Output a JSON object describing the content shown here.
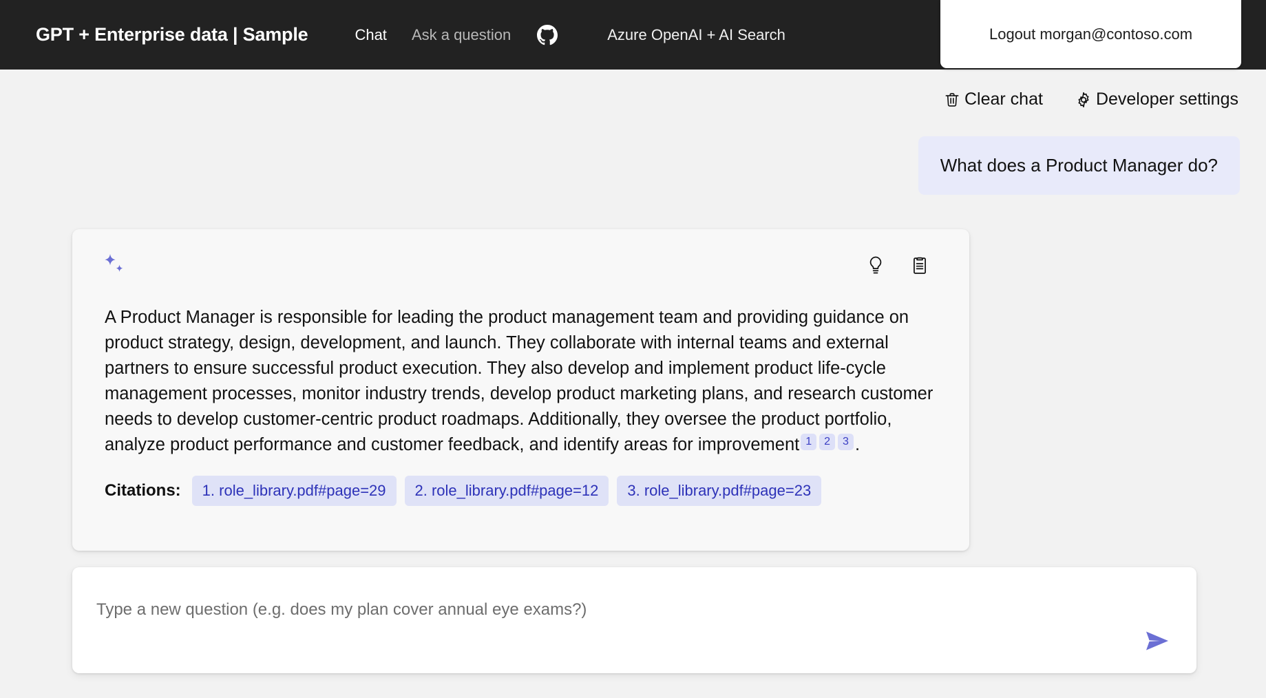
{
  "header": {
    "brand_title": "GPT + Enterprise data | Sample",
    "nav": [
      {
        "label": "Chat",
        "name": "nav-link-chat",
        "active": true
      },
      {
        "label": "Ask a question",
        "name": "nav-link-ask-a-question",
        "active": false
      }
    ],
    "github_icon": "github-icon",
    "azure_label": "Azure OpenAI + AI Search",
    "logout_label": "Logout morgan@contoso.com",
    "background_color": "#222222"
  },
  "toolbar": {
    "clear_chat_label": "Clear chat",
    "clear_chat_icon": "trash-icon",
    "developer_settings_label": "Developer settings",
    "developer_settings_icon": "gear-icon"
  },
  "conversation": {
    "user_message": "What does a Product Manager do?",
    "answer": {
      "avatar_icon": "sparkle-icon",
      "actions": [
        {
          "name": "thought-process-button",
          "icon": "lightbulb-icon"
        },
        {
          "name": "supporting-content-button",
          "icon": "clipboard-icon"
        }
      ],
      "text_part_1": "A Product Manager is responsible for leading the product management team and providing guidance on product strategy, design, development, and launch. They collaborate with internal teams and external partners to ensure successful product execution. They also develop and implement product life-cycle management processes, monitor industry trends, develop product marketing plans, and research customer needs to develop customer-centric product roadmaps. Additionally, they oversee the product portfolio, analyze product performance and customer feedback, and identify areas for improvement",
      "inline_citations": [
        "1",
        "2",
        "3"
      ],
      "text_part_2": ".",
      "citations_label": "Citations:",
      "citations": [
        "1. role_library.pdf#page=29",
        "2. role_library.pdf#page=12",
        "3. role_library.pdf#page=23"
      ]
    }
  },
  "question_input": {
    "value": "",
    "placeholder": "Type a new question (e.g. does my plan cover annual eye exams?)",
    "send_icon": "send-icon"
  },
  "colors": {
    "page_background": "#f2f2f2",
    "header_background": "#222222",
    "user_bubble": "#e8eafa",
    "answer_card": "#f8f8f8",
    "accent_purple": "#6b6fd4",
    "citation_chip_bg": "#dfe2f7",
    "citation_chip_text": "#2d32b8"
  }
}
